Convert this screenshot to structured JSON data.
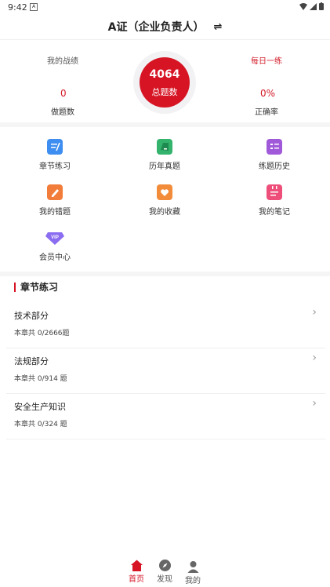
{
  "status": {
    "time": "9:42",
    "sim": "A"
  },
  "header": {
    "title": "A证（企业负责人）",
    "swap_icon": "⇌"
  },
  "stats": {
    "my_record_label": "我的战绩",
    "daily_label": "每日一练",
    "done_value": "0",
    "done_label": "做题数",
    "total_value": "4064",
    "total_label": "总题数",
    "accuracy_value": "0%",
    "accuracy_label": "正确率"
  },
  "grid": [
    {
      "label": "章节练习",
      "icon": "chapter-practice-icon",
      "color": "#3d8ef0"
    },
    {
      "label": "历年真题",
      "icon": "past-exam-icon",
      "color": "#33b36c"
    },
    {
      "label": "练题历史",
      "icon": "history-icon",
      "color": "#a05ad9"
    },
    {
      "label": "我的错题",
      "icon": "wrong-questions-icon",
      "color": "#f27d3a"
    },
    {
      "label": "我的收藏",
      "icon": "favorites-icon",
      "color": "#f28c3b"
    },
    {
      "label": "我的笔记",
      "icon": "notes-icon",
      "color": "#ee4f7a"
    },
    {
      "label": "会员中心",
      "icon": "vip-icon",
      "color": "#8a6df0"
    }
  ],
  "section": {
    "title": "章节练习"
  },
  "chapters": [
    {
      "name": "技术部分",
      "count": "本章共 0/2666题"
    },
    {
      "name": "法规部分",
      "count": "本章共 0/914 题"
    },
    {
      "name": "安全生产知识",
      "count": "本章共 0/324 题"
    }
  ],
  "tabs": [
    {
      "label": "首页",
      "active": true
    },
    {
      "label": "发现",
      "active": false
    },
    {
      "label": "我的",
      "active": false
    }
  ],
  "colors": {
    "accent": "#d61424",
    "inactive": "#555555"
  }
}
